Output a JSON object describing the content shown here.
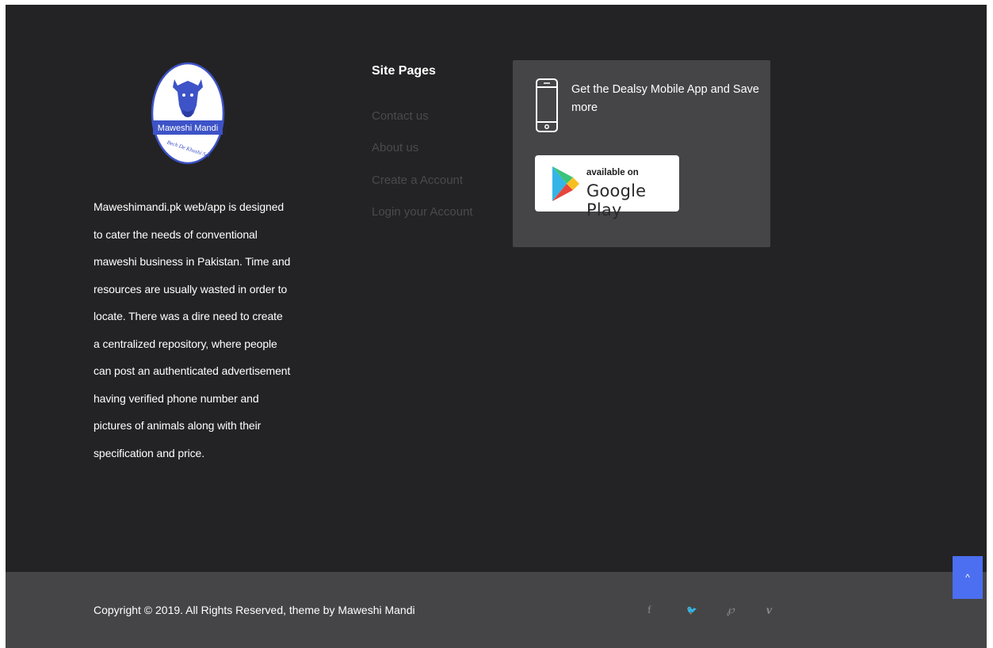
{
  "brand": {
    "logo_text": "Maweshi Mandi",
    "logo_tagline": "Bech De Khushi Sai",
    "description": "Maweshimandi.pk web/app is designed to cater the needs of conventional maweshi business in Pakistan. Time and resources are usually wasted in order to locate. There was a dire need to create a centralized repository, where people can post an authenticated advertisement having verified phone number and pictures of animals along with their specification and price."
  },
  "site_pages": {
    "title": "Site Pages",
    "links": [
      {
        "label": "Contact us"
      },
      {
        "label": "About us"
      },
      {
        "label": "Create a Account"
      },
      {
        "label": "Login your Account"
      }
    ]
  },
  "app_promo": {
    "text": "Get the Dealsy Mobile App and Save more",
    "icon": "mobile-phone-icon",
    "store_badge": {
      "small_text": "available on",
      "store_name": "Google Play",
      "icon": "google-play-icon"
    }
  },
  "bottom_bar": {
    "copyright": "Copyright © 2019. All Rights Reserved, theme by Maweshi Mandi",
    "social": [
      {
        "name": "facebook-icon",
        "glyph": "f"
      },
      {
        "name": "twitter-icon",
        "glyph": "🐦"
      },
      {
        "name": "pinterest-icon",
        "glyph": "℘"
      },
      {
        "name": "vimeo-icon",
        "glyph": "v"
      }
    ]
  },
  "scroll_top": {
    "glyph": "^",
    "icon": "chevron-up-icon"
  },
  "colors": {
    "footer_bg": "#232325",
    "bottom_bar_bg": "#454547",
    "app_box_bg": "#454547",
    "link_color": "#4a4a4d",
    "accent": "#4b6ff0",
    "logo_blue": "#3d53c7"
  }
}
